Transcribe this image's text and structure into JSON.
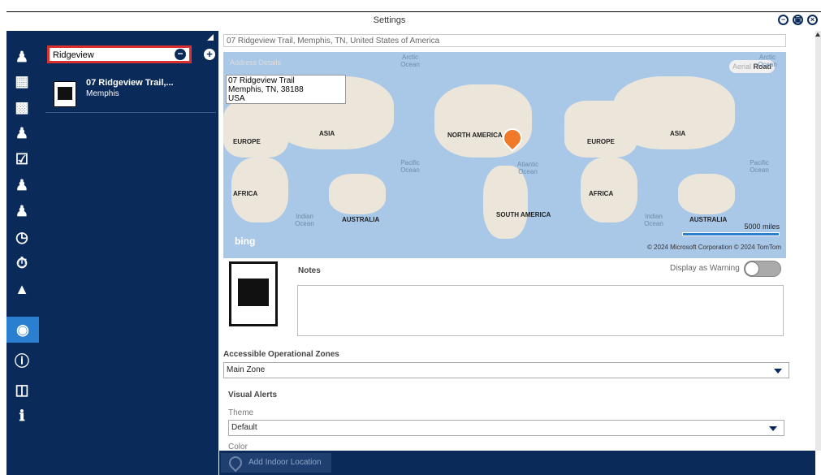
{
  "window": {
    "title": "Settings"
  },
  "sidebar": {
    "items": [
      {
        "icon": "user-settings-icon"
      },
      {
        "icon": "grid-icon"
      },
      {
        "icon": "bar-chart-icon"
      },
      {
        "icon": "user-block-icon"
      },
      {
        "icon": "checklist-icon"
      },
      {
        "icon": "users-icon"
      },
      {
        "icon": "user-icon"
      },
      {
        "icon": "timer-icon"
      },
      {
        "icon": "stopwatch-icon"
      },
      {
        "icon": "bell-icon"
      },
      {
        "icon": "location-add-icon",
        "active": true
      },
      {
        "icon": "alert-icon"
      },
      {
        "icon": "documents-icon"
      },
      {
        "icon": "info-icon"
      }
    ]
  },
  "list": {
    "search_value": "Ridgeview",
    "items": [
      {
        "title": "07 Ridgeview Trail,...",
        "subtitle": "Memphis"
      }
    ]
  },
  "detail": {
    "address_bar": "07 Ridgeview Trail, Memphis, TN, United States of America",
    "map": {
      "address_details_label": "Address Details",
      "popup_lines": [
        "07 Ridgeview Trail",
        "Memphis, TN, 38188",
        "USA"
      ],
      "toggle_aerial": "Aerial",
      "toggle_road": "Road",
      "oceans": [
        "Arctic Ocean",
        "Arctic Ocean",
        "Pacific Ocean",
        "Atlantic Ocean",
        "Pacific Ocean",
        "Indian Ocean",
        "Indian Ocean"
      ],
      "continents": [
        "EUROPE",
        "ASIA",
        "NORTH AMERICA",
        "EUROPE",
        "ASIA",
        "AFRICA",
        "AFRICA",
        "SOUTH AMERICA",
        "AUSTRALIA",
        "AUSTRALIA"
      ],
      "brand": "bing",
      "scale": "5000 miles",
      "copyright": "© 2024 Microsoft Corporation   © 2024 TomTom"
    },
    "notes_label": "Notes",
    "display_warning_label": "Display as Warning",
    "zones_label": "Accessible Operational Zones",
    "zones_value": "Main Zone",
    "visual_alerts_label": "Visual Alerts",
    "theme_label": "Theme",
    "theme_value": "Default",
    "color_label": "Color",
    "add_indoor_label": "Add Indoor Location"
  }
}
